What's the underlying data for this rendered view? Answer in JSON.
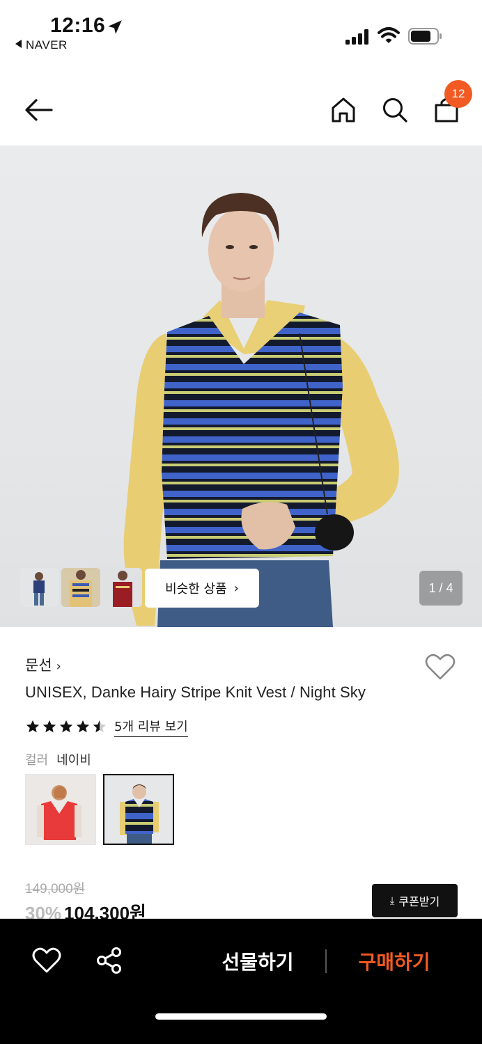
{
  "status_bar": {
    "time": "12:16",
    "back_app": "NAVER",
    "icons": [
      "location-arrow-icon",
      "signal-icon",
      "wifi-icon",
      "battery-icon"
    ]
  },
  "top_nav": {
    "icons": [
      "back-arrow-icon",
      "home-icon",
      "search-icon",
      "shopping-bag-icon"
    ],
    "cart_count": "12"
  },
  "gallery": {
    "similar_label": "비슷한 상품",
    "similar_chevron": "›",
    "page_counter": "1 / 4",
    "thumbnail_count": 3
  },
  "product": {
    "brand": "문선",
    "brand_arrow": "›",
    "title": "UNISEX, Danke Hairy Stripe Knit Vest / Night Sky",
    "rating": 4.5,
    "review_link": "5개 리뷰 보기",
    "color_label": "컬러",
    "color_value": "네이비",
    "color_options": [
      "red-vest",
      "navy-vest"
    ],
    "selected_color_index": 1,
    "original_price": "149,000원",
    "discount": "30%",
    "sale_price": "104,300원",
    "coupon_label": "쿠폰받기",
    "coupon_icon": "⤓"
  },
  "bottom_bar": {
    "gift_label": "선물하기",
    "buy_label": "구매하기",
    "icons": [
      "heart-icon",
      "share-icon"
    ]
  },
  "colors": {
    "accent": "#f15a22",
    "bottom_bar_bg": "#000000",
    "text": "#111111"
  }
}
